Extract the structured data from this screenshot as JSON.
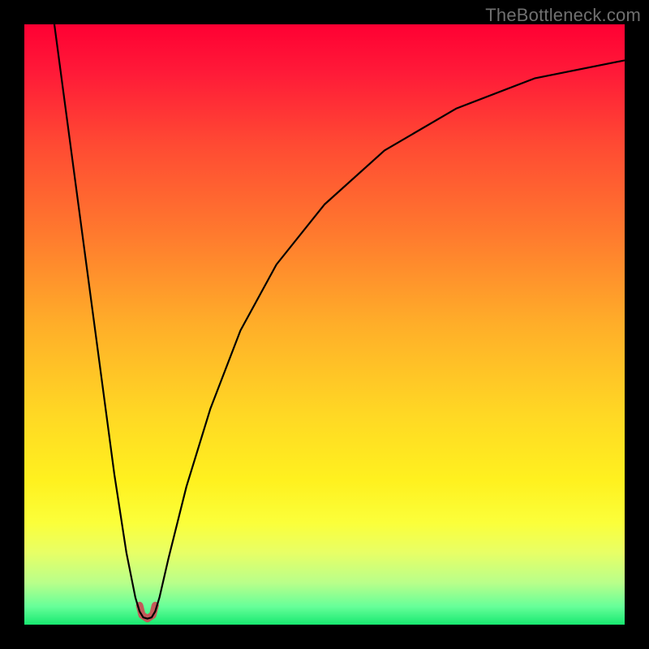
{
  "watermark": "TheBottleneck.com",
  "chart_data": {
    "type": "line",
    "title": "",
    "xlabel": "",
    "ylabel": "",
    "xlim": [
      0,
      100
    ],
    "ylim": [
      0,
      100
    ],
    "background": {
      "type": "vertical-gradient",
      "stops": [
        {
          "offset": 0.0,
          "color": "#ff0033"
        },
        {
          "offset": 0.08,
          "color": "#ff1a38"
        },
        {
          "offset": 0.2,
          "color": "#ff4a33"
        },
        {
          "offset": 0.35,
          "color": "#ff7a2e"
        },
        {
          "offset": 0.5,
          "color": "#ffae29"
        },
        {
          "offset": 0.65,
          "color": "#ffd824"
        },
        {
          "offset": 0.76,
          "color": "#fff11f"
        },
        {
          "offset": 0.83,
          "color": "#fbff3a"
        },
        {
          "offset": 0.88,
          "color": "#e8ff66"
        },
        {
          "offset": 0.93,
          "color": "#b9ff8a"
        },
        {
          "offset": 0.97,
          "color": "#66ff99"
        },
        {
          "offset": 1.0,
          "color": "#18e870"
        }
      ]
    },
    "series": [
      {
        "name": "bottleneck-curve",
        "color": "#000000",
        "width": 2.2,
        "points": [
          {
            "x": 5.0,
            "y": 100.0
          },
          {
            "x": 7.0,
            "y": 85.0
          },
          {
            "x": 9.0,
            "y": 70.0
          },
          {
            "x": 11.0,
            "y": 55.0
          },
          {
            "x": 13.0,
            "y": 40.0
          },
          {
            "x": 15.0,
            "y": 25.0
          },
          {
            "x": 17.0,
            "y": 12.0
          },
          {
            "x": 18.5,
            "y": 4.5
          },
          {
            "x": 19.2,
            "y": 2.2
          },
          {
            "x": 19.8,
            "y": 1.2
          },
          {
            "x": 20.5,
            "y": 1.0
          },
          {
            "x": 21.2,
            "y": 1.2
          },
          {
            "x": 21.8,
            "y": 2.2
          },
          {
            "x": 22.5,
            "y": 4.5
          },
          {
            "x": 24.0,
            "y": 11.0
          },
          {
            "x": 27.0,
            "y": 23.0
          },
          {
            "x": 31.0,
            "y": 36.0
          },
          {
            "x": 36.0,
            "y": 49.0
          },
          {
            "x": 42.0,
            "y": 60.0
          },
          {
            "x": 50.0,
            "y": 70.0
          },
          {
            "x": 60.0,
            "y": 79.0
          },
          {
            "x": 72.0,
            "y": 86.0
          },
          {
            "x": 85.0,
            "y": 91.0
          },
          {
            "x": 100.0,
            "y": 94.0
          }
        ]
      },
      {
        "name": "sweet-spot-marker",
        "color": "#c35a5a",
        "width": 9,
        "linecap": "round",
        "points": [
          {
            "x": 19.2,
            "y": 3.2
          },
          {
            "x": 19.6,
            "y": 1.6
          },
          {
            "x": 20.5,
            "y": 1.0
          },
          {
            "x": 21.4,
            "y": 1.6
          },
          {
            "x": 21.8,
            "y": 3.2
          }
        ]
      }
    ]
  }
}
